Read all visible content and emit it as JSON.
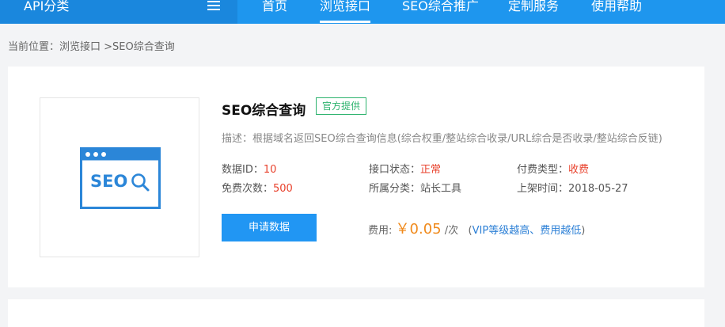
{
  "nav": {
    "api_category": "API分类",
    "items": [
      "首页",
      "浏览接口",
      "SEO综合推广",
      "定制服务",
      "使用帮助"
    ],
    "active_index": 1
  },
  "breadcrumb": "当前位置：浏览接口 >SEO综合查询",
  "api": {
    "title": "SEO综合查询",
    "badge": "官方提供",
    "logo_text": "SEO",
    "description": "描述：根据域名返回SEO综合查询信息(综合权重/整站综合收录/URL综合是否收录/整站综合反链)",
    "meta": {
      "data_id_label": "数据ID：",
      "data_id_value": "10",
      "status_label": "接口状态：",
      "status_value": "正常",
      "pay_type_label": "付费类型：",
      "pay_type_value": "收费",
      "free_times_label": "免费次数：",
      "free_times_value": "500",
      "category_label": "所属分类：",
      "category_value": "站长工具",
      "release_label": "上架时间：",
      "release_value": "2018-05-27"
    },
    "apply_button": "申请数据",
    "fee": {
      "label": "费用:",
      "price": "￥0.05",
      "unit": "/次",
      "note_open": "(",
      "note": "VIP等级越高、费用越低",
      "note_close": ")"
    }
  },
  "colors": {
    "nav_bg": "#1e96ee",
    "accent": "#2196f3",
    "badge_green": "#2db36e",
    "red": "#e8412c",
    "price_orange": "#f08a1c"
  }
}
